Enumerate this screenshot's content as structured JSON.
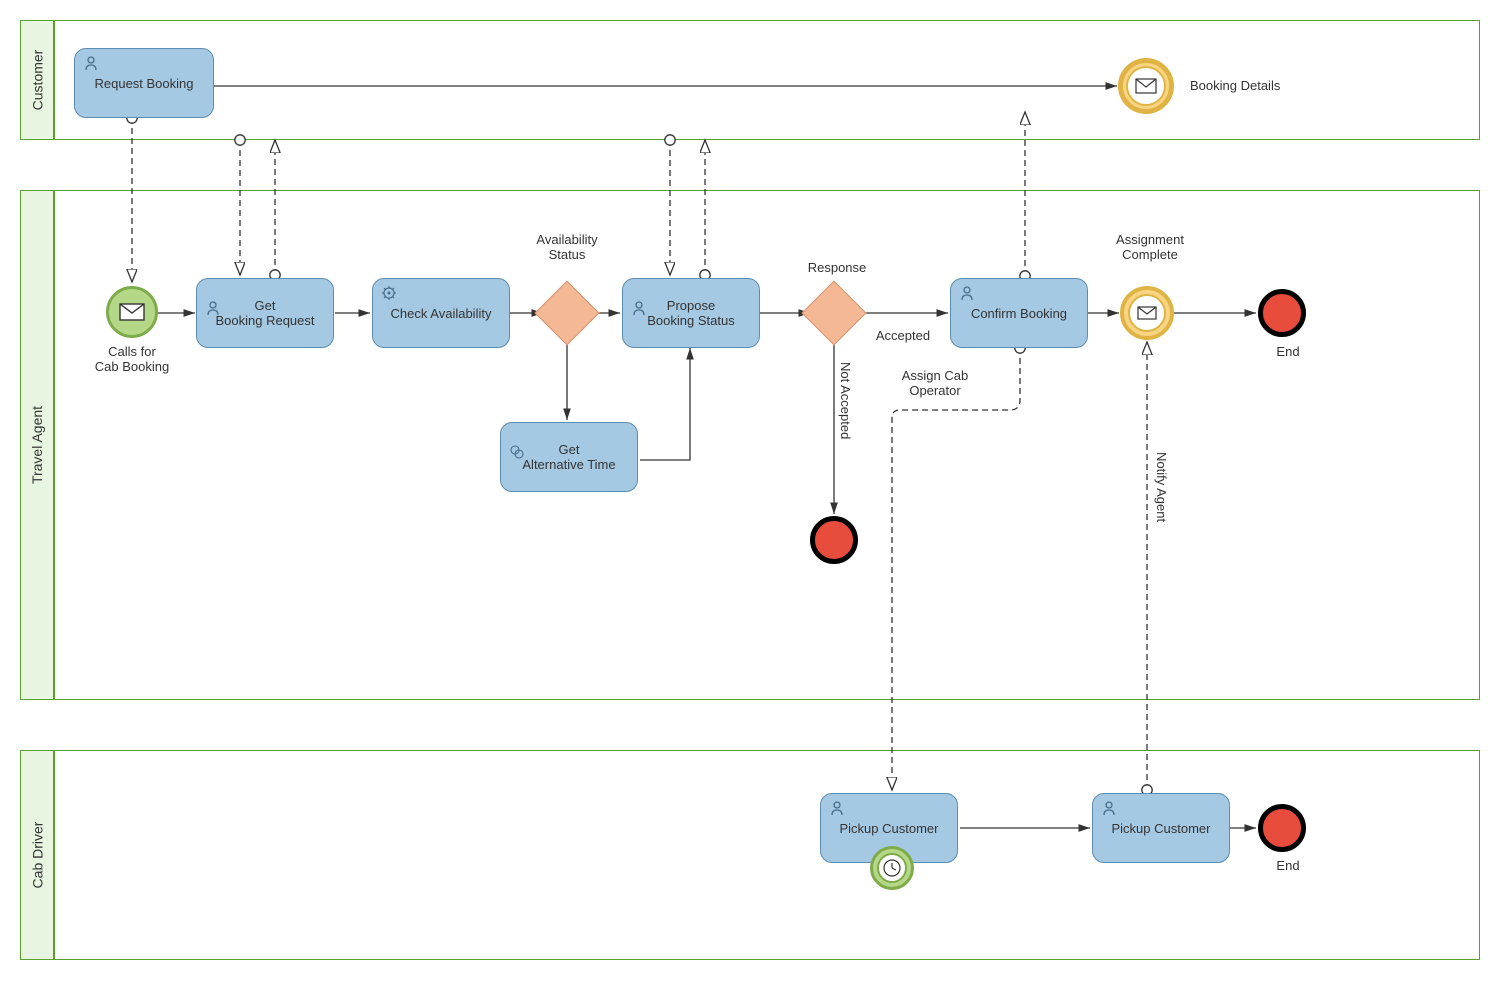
{
  "lanes": {
    "customer": "Customer",
    "agent": "Travel Agent",
    "driver": "Cab Driver"
  },
  "tasks": {
    "request_booking": "Request Booking",
    "get_booking_request": "Get\nBooking Request",
    "check_availability": "Check Availability",
    "propose_booking_status": "Propose\nBooking Status",
    "get_alternative_time": "Get\nAlternative Time",
    "confirm_booking": "Confirm Booking",
    "pickup_customer1": "Pickup Customer",
    "pickup_customer2": "Pickup Customer"
  },
  "labels": {
    "calls_for_cab": "Calls for\nCab Booking",
    "availability_status": "Availability\nStatus",
    "response": "Response",
    "accepted": "Accepted",
    "not_accepted": "Not Accepted",
    "assign_cab_operator": "Assign Cab\nOperator",
    "booking_details": "Booking Details",
    "assignment_complete": "Assignment\nComplete",
    "notify_agent": "Notify Agent",
    "end1": "End",
    "end2": "End"
  },
  "colors": {
    "task_fill": "#a5c9e3",
    "task_border": "#5b8db3",
    "lane_border": "#5aa02c",
    "lane_label_bg": "#e8f5e1",
    "gateway_fill": "#f5b894",
    "end_fill": "#e84c3d",
    "msg_ring": "#a6c96a",
    "throw_ring": "#f4c657"
  }
}
